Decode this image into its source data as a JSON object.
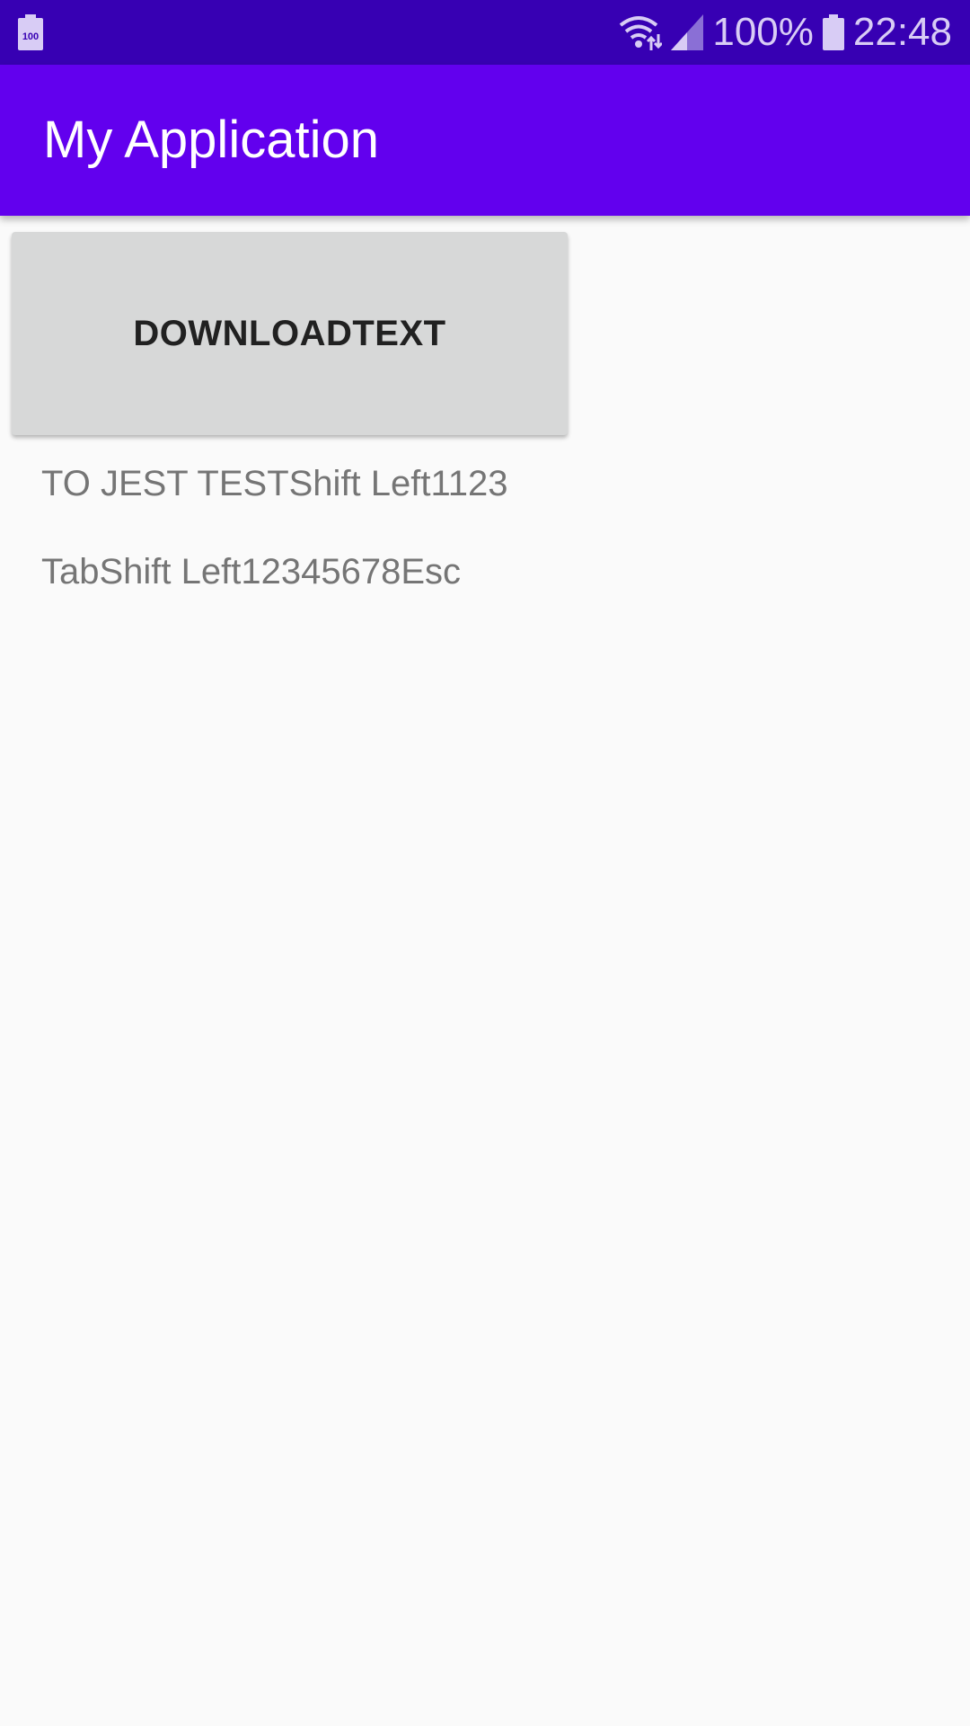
{
  "status_bar": {
    "battery_percent": "100%",
    "time": "22:48",
    "left_icon_label": "100",
    "icons": [
      "battery-notification-icon",
      "wifi-icon",
      "signal-icon",
      "battery-icon"
    ]
  },
  "app_bar": {
    "title": "My Application"
  },
  "main": {
    "button_label": "DOWNLOADTEXT",
    "text_lines": [
      "TO JEST TESTShift Left1123",
      "TabShift Left12345678Esc"
    ]
  },
  "colors": {
    "status_bar_bg": "#3700b3",
    "app_bar_bg": "#6200ee",
    "page_bg": "#fafafa",
    "button_bg": "#d7d8d8",
    "body_text": "#757575"
  }
}
